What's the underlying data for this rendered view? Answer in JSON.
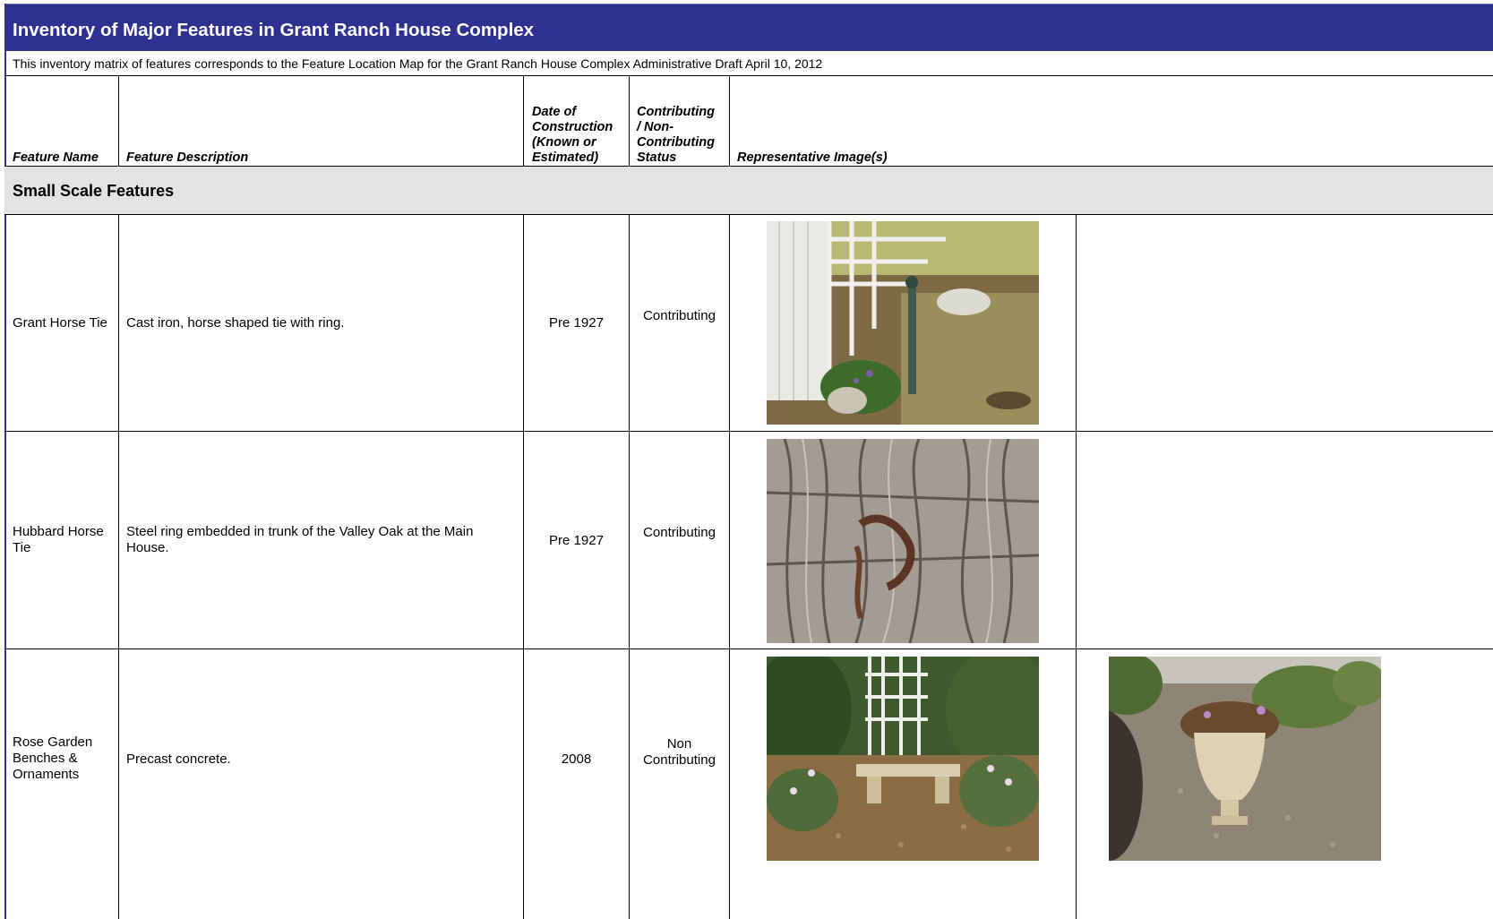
{
  "title": "Inventory of Major Features in Grant Ranch House Complex",
  "subtitle": "This inventory matrix of features corresponds to the Feature Location Map for the Grant Ranch House Complex  Administrative Draft April 10, 2012",
  "headers": {
    "feature_name": "Feature Name",
    "feature_description": "Feature Description",
    "date_line1": "Date of",
    "date_line2": "Construction",
    "date_line3": "(Known or",
    "date_line4": "Estimated)",
    "status_line1": "Contributing",
    "status_line2": "/ Non-",
    "status_line3": "Contributing",
    "status_line4": "Status",
    "images": "Representative Image(s)"
  },
  "section": "Small Scale Features",
  "rows": [
    {
      "name_line1": "Grant Horse Tie",
      "name_line2": "",
      "name_line3": "",
      "desc_line1": "Cast iron, horse shaped tie with ring.",
      "desc_line2": "",
      "date": "Pre 1927",
      "status_line1": "Contributing",
      "status_line2": "",
      "images": [
        "horse-tie-fence-photo"
      ]
    },
    {
      "name_line1": "Hubbard Horse",
      "name_line2": "Tie",
      "name_line3": "",
      "desc_line1": "Steel ring embedded in trunk of the Valley Oak at the Main",
      "desc_line2": "House.",
      "date": "Pre 1927",
      "status_line1": "Contributing",
      "status_line2": "",
      "images": [
        "oak-trunk-ring-photo"
      ]
    },
    {
      "name_line1": "Rose Garden",
      "name_line2": "Benches &",
      "name_line3": "Ornaments",
      "desc_line1": "Precast concrete.",
      "desc_line2": "",
      "date": "2008",
      "status_line1": "Non",
      "status_line2": "Contributing",
      "images": [
        "garden-bench-photo",
        "urn-planter-photo"
      ]
    }
  ],
  "colors": {
    "title_bg": "#2e3190",
    "section_bg": "#e3e3e3"
  }
}
